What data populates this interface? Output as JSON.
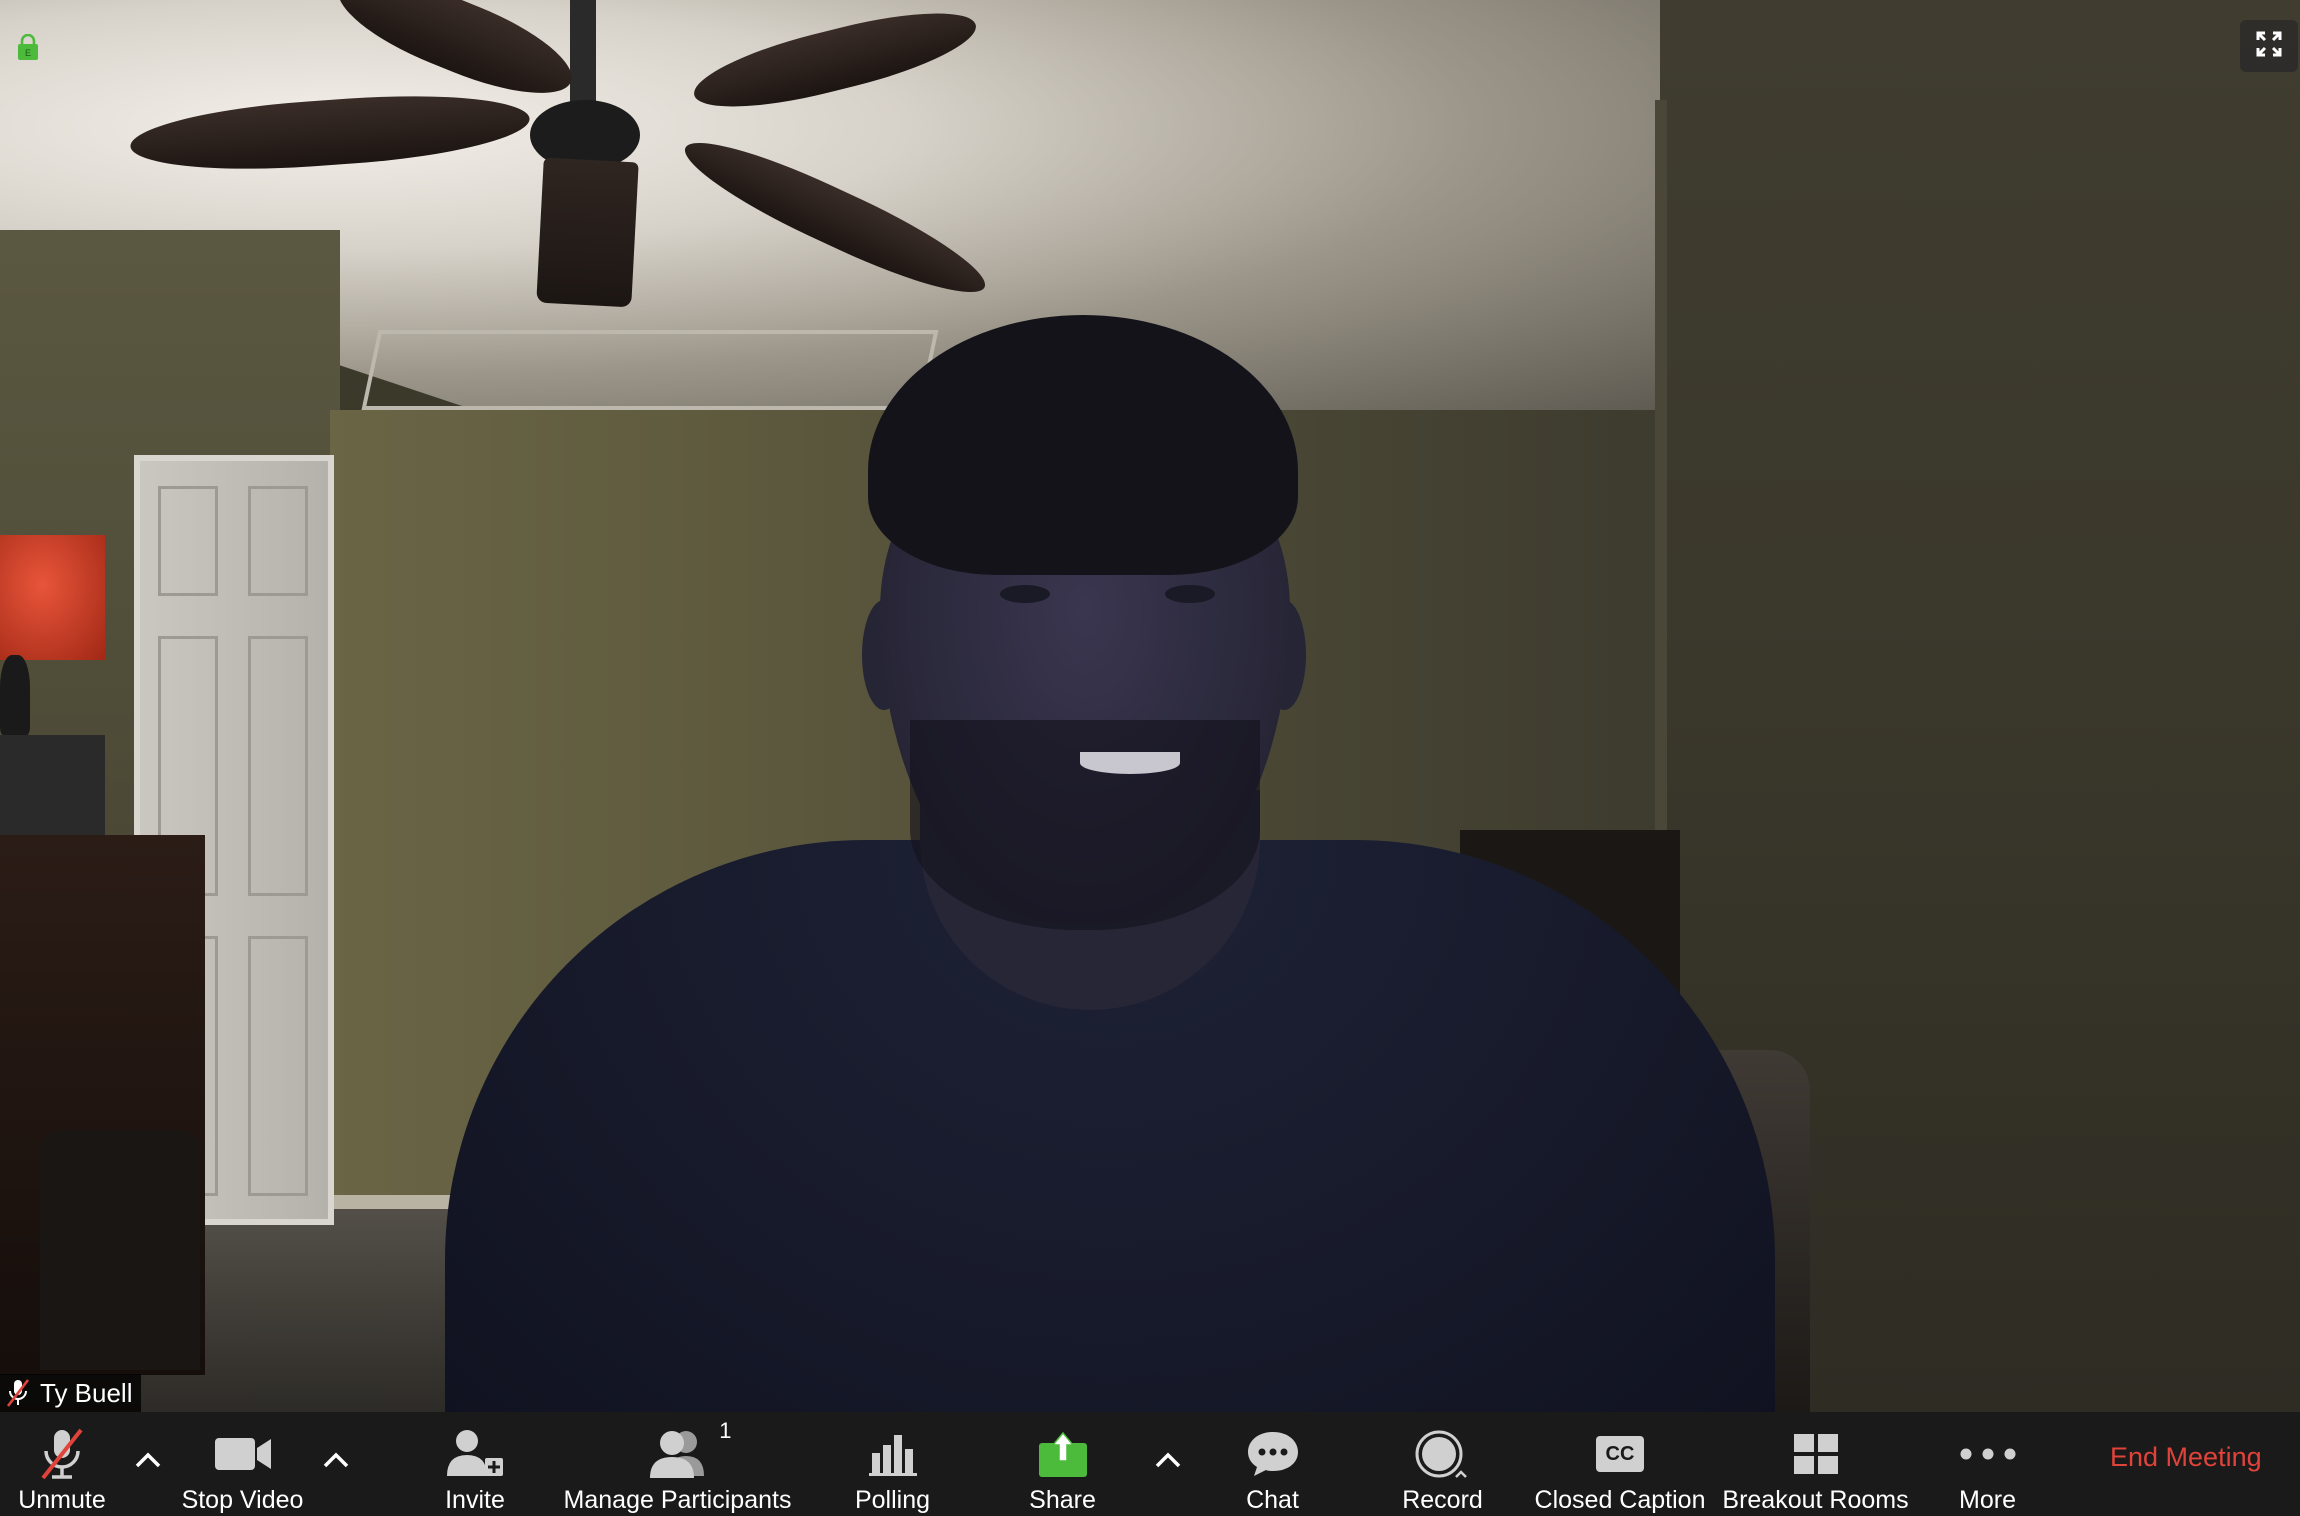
{
  "participant": {
    "name": "Ty Buell",
    "muted": true
  },
  "icons": {
    "security": "lock-icon",
    "fullscreen": "fullscreen-icon",
    "name_tag_mic": "microphone-muted-icon"
  },
  "toolbar": {
    "unmute": {
      "label": "Unmute",
      "icon": "microphone-muted-icon"
    },
    "stop_video": {
      "label": "Stop Video",
      "icon": "video-camera-icon"
    },
    "invite": {
      "label": "Invite",
      "icon": "add-person-icon"
    },
    "manage_participants": {
      "label": "Manage Participants",
      "icon": "participants-icon",
      "count": "1"
    },
    "polling": {
      "label": "Polling",
      "icon": "bar-chart-icon"
    },
    "share": {
      "label": "Share",
      "icon": "share-screen-icon"
    },
    "chat": {
      "label": "Chat",
      "icon": "chat-bubble-icon"
    },
    "record": {
      "label": "Record",
      "icon": "record-icon"
    },
    "closed_caption": {
      "label": "Closed Caption",
      "icon": "cc-icon",
      "icon_text": "CC"
    },
    "breakout_rooms": {
      "label": "Breakout Rooms",
      "icon": "grid-icon"
    },
    "more": {
      "label": "More",
      "icon": "ellipsis-icon"
    },
    "end_meeting": {
      "label": "End Meeting"
    }
  },
  "colors": {
    "toolbar_bg": "#1a1a1a",
    "end_meeting": "#e0433a",
    "share_green": "#4cbb3c",
    "mute_red": "#e0433a",
    "lock_green": "#4cbb3c"
  }
}
